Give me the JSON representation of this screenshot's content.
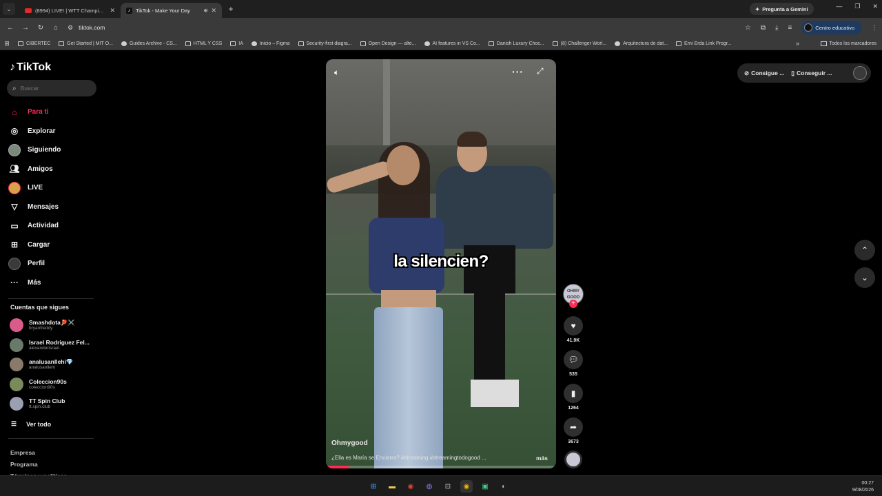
{
  "browser": {
    "tab_menu_icon": "chevron-down-icon",
    "tabs": [
      {
        "title": "(8994) LIVE! | WTT Champions",
        "favicon": "youtube-icon",
        "active": false
      },
      {
        "title": "TikTok - Make Your Day",
        "favicon": "tiktok-icon",
        "active": true
      }
    ],
    "new_tab_label": "+",
    "gemini_label": "Pregunta a Gemini",
    "url": "tiktok.com",
    "profile_label": "Centro educativo",
    "bookmarks": [
      "CIBERTEC",
      "Get Started | MIT O...",
      "Guides Archive - CS...",
      "HTML Y CSS",
      "IA",
      "Inicio – Figma",
      "Security-first diagra...",
      "Open Design — alte...",
      "AI features in VS Co...",
      "Danish Luxury Choc...",
      "(8) Challenger Worl...",
      "Arquitectura de dat...",
      "Erni Erda Link Progr..."
    ],
    "bookmarks_more": "»",
    "all_bookmarks": "Todos los marcadores"
  },
  "sidebar": {
    "logo": "TikTok",
    "search_placeholder": "Buscar",
    "nav": [
      {
        "label": "Para ti",
        "icon": "home-icon",
        "active": true
      },
      {
        "label": "Explorar",
        "icon": "compass-icon"
      },
      {
        "label": "Siguiendo",
        "icon": "following-avatar-icon"
      },
      {
        "label": "Amigos",
        "icon": "friends-icon"
      },
      {
        "label": "LIVE",
        "icon": "live-icon"
      },
      {
        "label": "Mensajes",
        "icon": "messages-icon"
      },
      {
        "label": "Actividad",
        "icon": "activity-icon"
      },
      {
        "label": "Cargar",
        "icon": "upload-icon"
      },
      {
        "label": "Perfil",
        "icon": "profile-avatar-icon"
      },
      {
        "label": "Más",
        "icon": "more-icon"
      }
    ],
    "following_title": "Cuentas que sigues",
    "following": [
      {
        "name": "Smashdota🏓⚔️",
        "handle": "bryanfreddy",
        "color": "#d85b8a"
      },
      {
        "name": "Israel Rodriguez Fel...",
        "handle": "alexanderisrael",
        "color": "#6a7a6a"
      },
      {
        "name": "analusanllehi💎",
        "handle": "analusanllehi",
        "color": "#8a7a6a"
      },
      {
        "name": "Coleccion90s",
        "handle": "coleccion90s",
        "color": "#7a8a5a"
      },
      {
        "name": "TT Spin Club",
        "handle": "tt.spin.club",
        "color": "#9aa0b0"
      }
    ],
    "see_all": "Ver todo",
    "footer": [
      "Empresa",
      "Programa",
      "Términos y políticas"
    ]
  },
  "video": {
    "caption_overlay": "la silencien?",
    "author": "Ohmygood",
    "description": "¿Ella es María se Encierra? #streaming #streamingtodogood ...",
    "more_label": "más",
    "progress": 0.1
  },
  "actions": {
    "avatar_text": "OHMY GOOD",
    "likes": "41.9K",
    "comments": "535",
    "saves": "1264",
    "shares": "3673"
  },
  "top_right": {
    "coins_label": "Consigue ...",
    "app_label": "Conseguir ..."
  },
  "taskbar": {
    "time": "00:27",
    "date": "9/08/2026"
  }
}
